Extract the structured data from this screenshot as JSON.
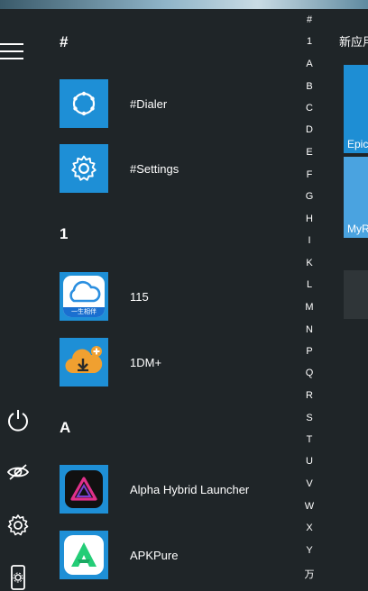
{
  "sidebar": {
    "menu_icon": "hamburger-menu-icon",
    "bottom_icons": [
      "power-icon",
      "hide-eye-icon",
      "gear-icon",
      "phone-settings-icon"
    ]
  },
  "sections": [
    {
      "header": "#",
      "apps": [
        {
          "label": "#Dialer",
          "icon": "dialer-icon"
        },
        {
          "label": "#Settings",
          "icon": "settings-gear-icon"
        }
      ]
    },
    {
      "header": "1",
      "apps": [
        {
          "label": "115",
          "icon": "cloud-115-icon",
          "icon_caption": "一生相伴"
        },
        {
          "label": "1DM+",
          "icon": "download-cloud-icon"
        }
      ]
    },
    {
      "header": "A",
      "apps": [
        {
          "label": "Alpha Hybrid Launcher",
          "icon": "alpha-triangle-icon"
        },
        {
          "label": "APKPure",
          "icon": "apkpure-icon"
        }
      ]
    }
  ],
  "alpha_index": [
    "#",
    "1",
    "A",
    "B",
    "C",
    "D",
    "E",
    "F",
    "G",
    "H",
    "I",
    "K",
    "L",
    "M",
    "N",
    "P",
    "Q",
    "R",
    "S",
    "T",
    "U",
    "V",
    "W",
    "X",
    "Y",
    "万"
  ],
  "right_panel": {
    "title": "新应用",
    "tiles": [
      {
        "label": "Epic"
      },
      {
        "label": "MyR"
      },
      {
        "label": ""
      }
    ]
  },
  "colors": {
    "background": "#1f2528",
    "tile_blue": "#1e8fd6",
    "panel_tile_blue": "#1e8ed4",
    "panel_tile_light": "#4aa3e0",
    "panel_tile_grey": "#2f3538"
  }
}
